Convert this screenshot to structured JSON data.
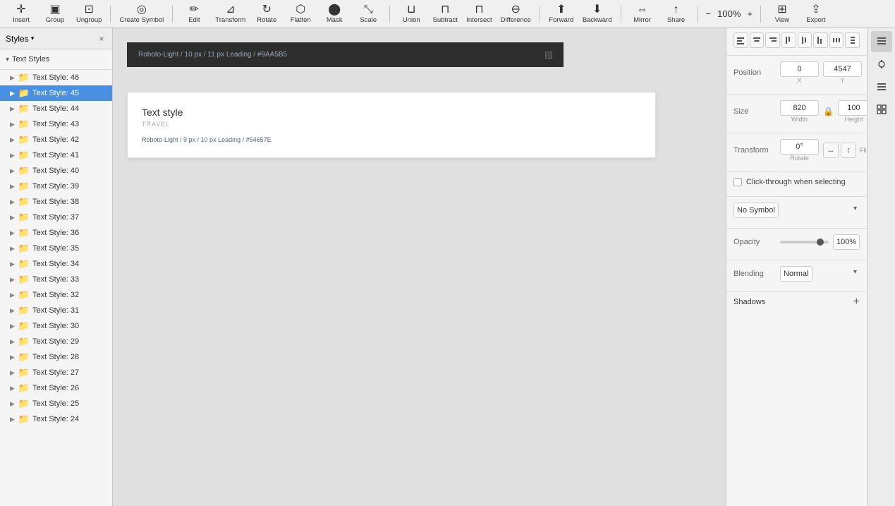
{
  "toolbar": {
    "insert_label": "Insert",
    "group_label": "Group",
    "ungroup_label": "Ungroup",
    "create_symbol_label": "Create Symbol",
    "edit_label": "Edit",
    "transform_label": "Transform",
    "rotate_label": "Rotate",
    "flatten_label": "Flatten",
    "mask_label": "Mask",
    "scale_label": "Scale",
    "union_label": "Union",
    "subtract_label": "Subtract",
    "intersect_label": "Intersect",
    "difference_label": "Difference",
    "forward_label": "Forward",
    "backward_label": "Backward",
    "mirror_label": "Mirror",
    "share_label": "Share",
    "view_label": "View",
    "export_label": "Export",
    "zoom_level": "100%",
    "zoom_minus": "−",
    "zoom_plus": "+"
  },
  "left_panel": {
    "styles_label": "Styles",
    "text_styles_label": "Text Styles",
    "close_icon": "×",
    "layers": [
      {
        "id": 46,
        "name": "Text Style: 46",
        "selected": false
      },
      {
        "id": 45,
        "name": "Text Style: 45",
        "selected": true
      },
      {
        "id": 44,
        "name": "Text Style: 44",
        "selected": false
      },
      {
        "id": 43,
        "name": "Text Style: 43",
        "selected": false
      },
      {
        "id": 42,
        "name": "Text Style: 42",
        "selected": false
      },
      {
        "id": 41,
        "name": "Text Style: 41",
        "selected": false
      },
      {
        "id": 40,
        "name": "Text Style: 40",
        "selected": false
      },
      {
        "id": 39,
        "name": "Text Style: 39",
        "selected": false
      },
      {
        "id": 38,
        "name": "Text Style: 38",
        "selected": false
      },
      {
        "id": 37,
        "name": "Text Style: 37",
        "selected": false
      },
      {
        "id": 36,
        "name": "Text Style: 36",
        "selected": false
      },
      {
        "id": 35,
        "name": "Text Style: 35",
        "selected": false
      },
      {
        "id": 34,
        "name": "Text Style: 34",
        "selected": false
      },
      {
        "id": 33,
        "name": "Text Style: 33",
        "selected": false
      },
      {
        "id": 32,
        "name": "Text Style: 32",
        "selected": false
      },
      {
        "id": 31,
        "name": "Text Style: 31",
        "selected": false
      },
      {
        "id": 30,
        "name": "Text Style: 30",
        "selected": false
      },
      {
        "id": 29,
        "name": "Text Style: 29",
        "selected": false
      },
      {
        "id": 28,
        "name": "Text Style: 28",
        "selected": false
      },
      {
        "id": 27,
        "name": "Text Style: 27",
        "selected": false
      },
      {
        "id": 26,
        "name": "Text Style: 26",
        "selected": false
      },
      {
        "id": 25,
        "name": "Text Style: 25",
        "selected": false
      },
      {
        "id": 24,
        "name": "Text Style: 24",
        "selected": false
      }
    ]
  },
  "canvas": {
    "dark_item_text": "Roboto-Light / 10 px / 11 px Leading / #9AA5B5",
    "light_item_title": "Text style",
    "light_item_subtitle": "TRAVEL",
    "light_item_body": "Roboto-Light / 9 px / 10 px Leading / #54657E"
  },
  "right_panel": {
    "position_label": "Position",
    "position_x": "0",
    "position_y": "4547",
    "x_label": "X",
    "y_label": "Y",
    "size_label": "Size",
    "width_value": "820",
    "height_value": "100",
    "width_label": "Width",
    "height_label": "Height",
    "lock_icon": "🔒",
    "transform_label": "Transform",
    "rotate_value": "0°",
    "rotate_label": "Rotate",
    "flip_label": "Flip",
    "click_through_label": "Click-through when selecting",
    "symbol_label": "No Symbol",
    "opacity_label": "Opacity",
    "opacity_value": "100%",
    "blending_label": "Blending",
    "blending_value": "Normal",
    "shadows_label": "Shadows",
    "add_icon": "+",
    "align_icons": [
      "⬛",
      "▥",
      "⬛",
      "⬛",
      "⬛",
      "⬛",
      "⬛"
    ]
  },
  "right_icons": {
    "inspector_icon": "▤",
    "link_icon": "🔗",
    "layers_icon": "◫",
    "grid_icon": "⊞"
  }
}
